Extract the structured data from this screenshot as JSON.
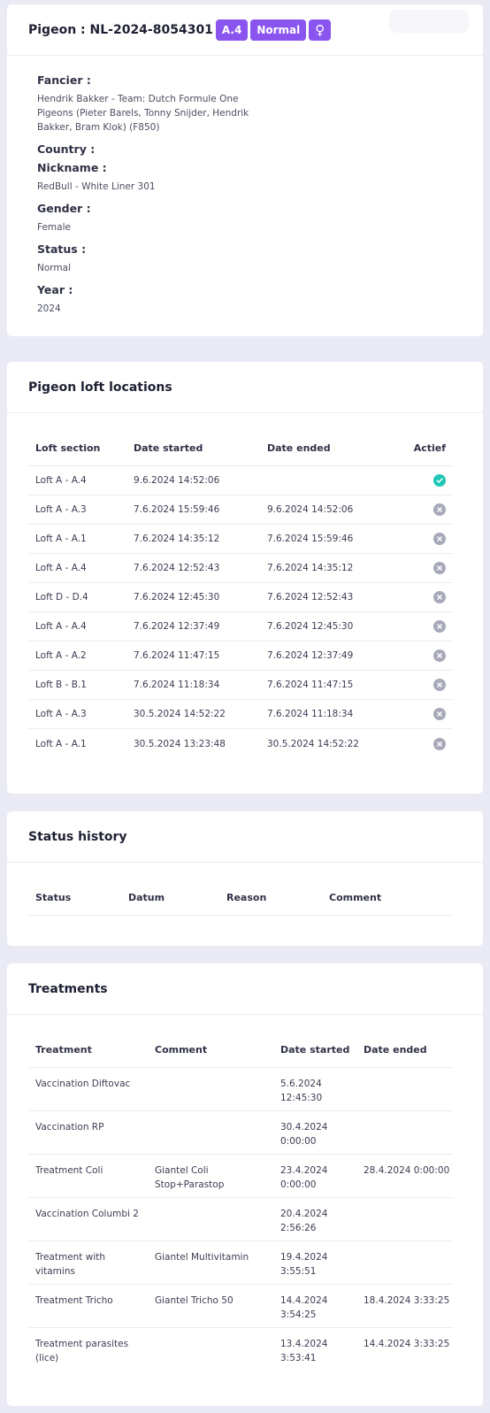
{
  "pigeon": {
    "title": "Pigeon : NL-2024-8054301",
    "badge_loft": "A.4",
    "badge_status": "Normal",
    "badge_gender_icon": "female-icon",
    "badge_gender_symbol": "♀",
    "badge_color": "#8a55ef"
  },
  "details": {
    "fancier_label": "Fancier :",
    "fancier_value": "Hendrik Bakker - Team: Dutch Formule One Pigeons (Pieter Barels, Tonny Snijder, Hendrik Bakker, Bram Klok) (F850)",
    "country_label": "Country :",
    "nickname_label": "Nickname :",
    "nickname_value": "RedBull - White Liner 301",
    "gender_label": "Gender :",
    "gender_value": "Female",
    "status_label": "Status :",
    "status_value": "Normal",
    "year_label": "Year :",
    "year_value": "2024"
  },
  "loft_locations": {
    "title": "Pigeon loft locations",
    "columns": [
      "Loft section",
      "Date started",
      "Date ended",
      "Actief"
    ],
    "rows": [
      {
        "section": "Loft A - A.4",
        "started": "9.6.2024 14:52:06",
        "ended": "",
        "active": true
      },
      {
        "section": "Loft A - A.3",
        "started": "7.6.2024 15:59:46",
        "ended": "9.6.2024 14:52:06",
        "active": false
      },
      {
        "section": "Loft A - A.1",
        "started": "7.6.2024 14:35:12",
        "ended": "7.6.2024 15:59:46",
        "active": false
      },
      {
        "section": "Loft A - A.4",
        "started": "7.6.2024 12:52:43",
        "ended": "7.6.2024 14:35:12",
        "active": false
      },
      {
        "section": "Loft D - D.4",
        "started": "7.6.2024 12:45:30",
        "ended": "7.6.2024 12:52:43",
        "active": false
      },
      {
        "section": "Loft A - A.4",
        "started": "7.6.2024 12:37:49",
        "ended": "7.6.2024 12:45:30",
        "active": false
      },
      {
        "section": "Loft A - A.2",
        "started": "7.6.2024 11:47:15",
        "ended": "7.6.2024 12:37:49",
        "active": false
      },
      {
        "section": "Loft B - B.1",
        "started": "7.6.2024 11:18:34",
        "ended": "7.6.2024 11:47:15",
        "active": false
      },
      {
        "section": "Loft A - A.3",
        "started": "30.5.2024 14:52:22",
        "ended": "7.6.2024 11:18:34",
        "active": false
      },
      {
        "section": "Loft A - A.1",
        "started": "30.5.2024 13:23:48",
        "ended": "30.5.2024 14:52:22",
        "active": false
      }
    ],
    "active_color": "#1fc7b4",
    "inactive_color": "#a7a9b8"
  },
  "status_history": {
    "title": "Status history",
    "columns": [
      "Status",
      "Datum",
      "Reason",
      "Comment"
    ]
  },
  "treatments": {
    "title": "Treatments",
    "columns": [
      "Treatment",
      "Comment",
      "Date started",
      "Date ended"
    ],
    "rows": [
      {
        "treatment": "Vaccination Diftovac",
        "comment": "",
        "started": "5.6.2024 12:45:30",
        "ended": ""
      },
      {
        "treatment": "Vaccination RP",
        "comment": "",
        "started": "30.4.2024 0:00:00",
        "ended": ""
      },
      {
        "treatment": "Treatment Coli",
        "comment": "Giantel Coli Stop+Parastop",
        "started": "23.4.2024 0:00:00",
        "ended": "28.4.2024 0:00:00"
      },
      {
        "treatment": "Vaccination Columbi 2",
        "comment": "",
        "started": "20.4.2024 2:56:26",
        "ended": ""
      },
      {
        "treatment": "Treatment with vitamins",
        "comment": "Giantel Multivitamin",
        "started": "19.4.2024 3:55:51",
        "ended": ""
      },
      {
        "treatment": "Treatment Tricho",
        "comment": "Giantel Tricho 50",
        "started": "14.4.2024 3:54:25",
        "ended": "18.4.2024 3:33:25"
      },
      {
        "treatment": "Treatment parasites (lice)",
        "comment": "",
        "started": "13.4.2024 3:53:41",
        "ended": "14.4.2024 3:33:25"
      }
    ]
  }
}
